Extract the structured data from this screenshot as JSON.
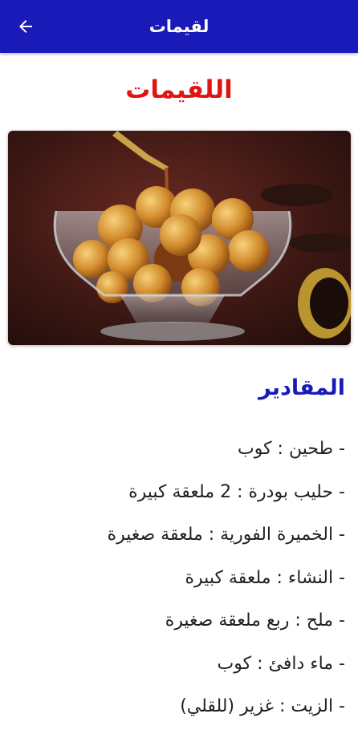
{
  "appbar": {
    "title": "لقيمات",
    "back_icon": "arrow-back-icon",
    "background": "#1a1ab8"
  },
  "recipe": {
    "heading": "اللقيمات",
    "heading_color": "#e11414",
    "image_alt_icon": "luqaimat-photo"
  },
  "ingredients": {
    "title": "المقادير",
    "title_color": "#1a1ab8",
    "items": [
      "- طحين : كوب",
      "- حليب بودرة : 2 ملعقة كبيرة",
      "- الخميرة الفورية : ملعقة صغيرة",
      "- النشاء : ملعقة كبيرة",
      "- ملح : ربع ملعقة صغيرة",
      "- ماء دافئ : كوب",
      "- الزيت : غزير (للقلي)"
    ]
  }
}
